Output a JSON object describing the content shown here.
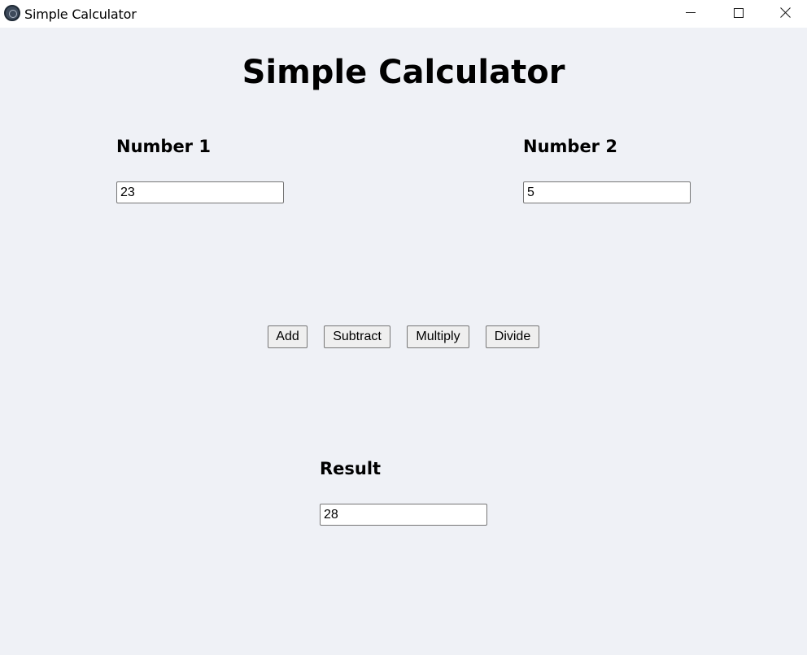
{
  "window": {
    "title": "Simple Calculator",
    "app_icon": "app-logo-icon",
    "controls": {
      "minimize": "minimize-icon",
      "maximize": "maximize-icon",
      "close": "close-icon"
    }
  },
  "page": {
    "heading": "Simple Calculator",
    "background_color": "#eff1f6"
  },
  "number1": {
    "label": "Number 1",
    "value": "23"
  },
  "number2": {
    "label": "Number 2",
    "value": "5"
  },
  "buttons": {
    "add": "Add",
    "subtract": "Subtract",
    "multiply": "Multiply",
    "divide": "Divide"
  },
  "result": {
    "label": "Result",
    "value": "28"
  }
}
